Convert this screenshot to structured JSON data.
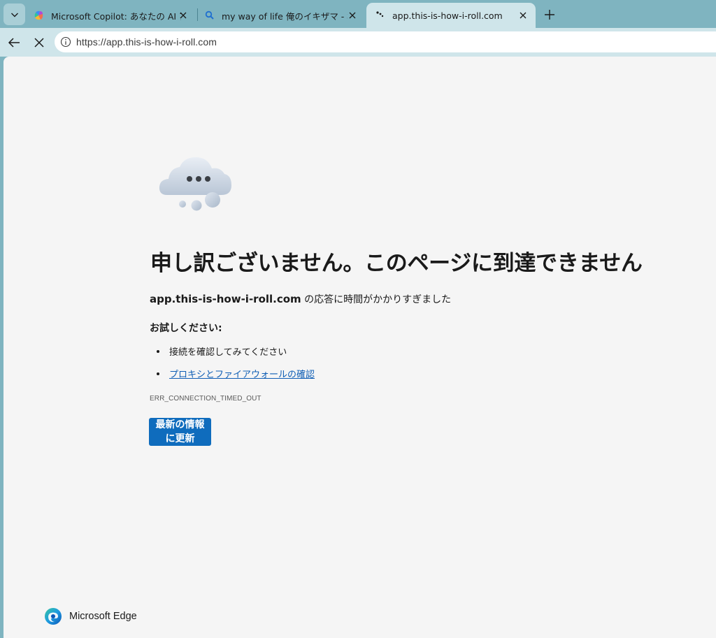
{
  "tabs": [
    {
      "title": "Microsoft Copilot: あなたの AI アシスタント",
      "favicon": "copilot-icon",
      "active": false
    },
    {
      "title": "my way of life 俺のイキザマ - 検索",
      "favicon": "search-icon",
      "active": false
    },
    {
      "title": "app.this-is-how-i-roll.com",
      "favicon": "loading-icon",
      "active": true
    }
  ],
  "toolbar": {
    "url": "https://app.this-is-how-i-roll.com"
  },
  "error_page": {
    "heading": "申し訳ございません。このページに到達できません",
    "domain": "app.this-is-how-i-roll.com",
    "message_suffix": " の応答に時間がかかりすぎました",
    "try_label": "お試しください:",
    "suggestions": [
      {
        "text": "接続を確認してみてください",
        "link": false
      },
      {
        "text": "プロキシとファイアウォールの確認",
        "link": true
      }
    ],
    "error_code": "ERR_CONNECTION_TIMED_OUT",
    "refresh_button": {
      "line1": "最新の情報",
      "line2": "に更新"
    }
  },
  "footer": {
    "brand": "Microsoft Edge"
  },
  "colors": {
    "frame": "#7fb4c0",
    "toolbar": "#cfe5ea",
    "page_bg": "#f5f5f5",
    "button": "#0f6cbd",
    "link": "#0f5eb5"
  }
}
